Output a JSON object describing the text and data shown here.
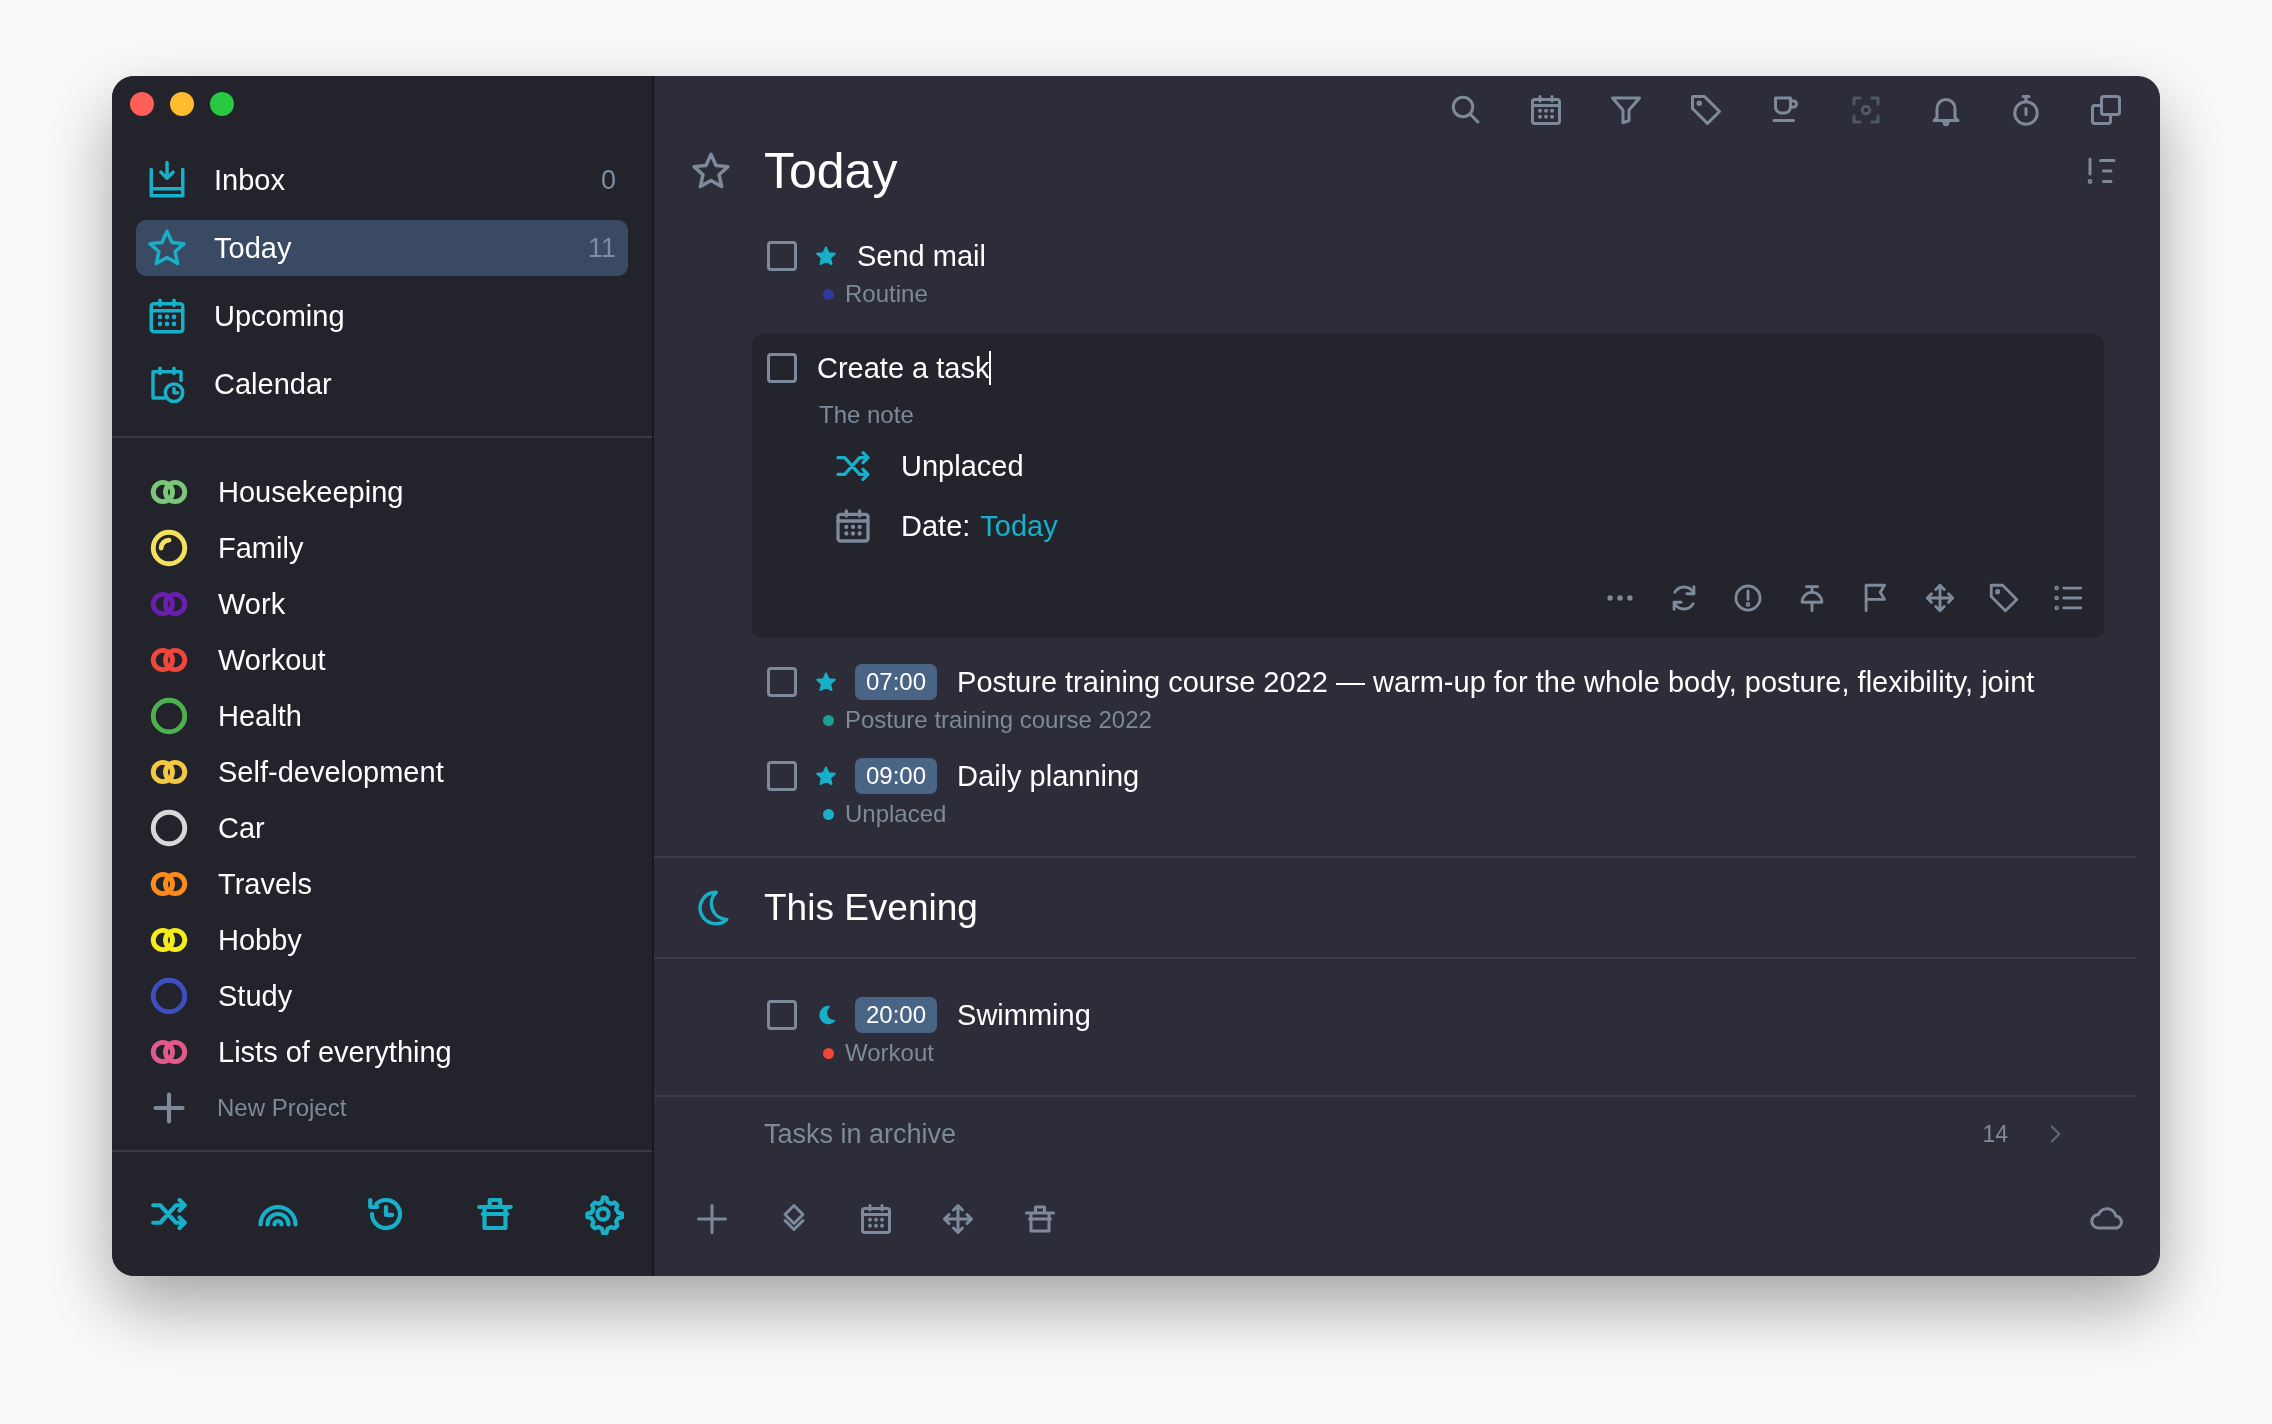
{
  "sidebar": {
    "nav": [
      {
        "label": "Inbox",
        "count": "0",
        "selected": false
      },
      {
        "label": "Today",
        "count": "11",
        "selected": true
      },
      {
        "label": "Upcoming",
        "selected": false
      },
      {
        "label": "Calendar",
        "selected": false
      }
    ],
    "projects": [
      {
        "name": "Housekeeping",
        "kind": "double",
        "color": "#7cc87a"
      },
      {
        "name": "Family",
        "kind": "arc",
        "color": "#f5e05a"
      },
      {
        "name": "Work",
        "kind": "double",
        "color": "#6a1fb0"
      },
      {
        "name": "Workout",
        "kind": "double",
        "color": "#f0463c"
      },
      {
        "name": "Health",
        "kind": "single",
        "color": "#4cb04c"
      },
      {
        "name": "Self-development",
        "kind": "double",
        "color": "#f5c842"
      },
      {
        "name": "Car",
        "kind": "single",
        "color": "#d8d8d8"
      },
      {
        "name": "Travels",
        "kind": "double",
        "color": "#ff8c1a"
      },
      {
        "name": "Hobby",
        "kind": "double",
        "color": "#f5ec1a"
      },
      {
        "name": "Study",
        "kind": "single",
        "color": "#3f4fc0"
      },
      {
        "name": "Lists of everything",
        "kind": "double",
        "color": "#e05a8a"
      }
    ],
    "new_project": "New Project"
  },
  "main": {
    "title": "Today",
    "sections": [
      {
        "tasks": [
          {
            "kind": "today",
            "title": "Send mail",
            "checked": false,
            "project": "Routine",
            "color": "#2f3aa0"
          },
          {
            "kind": "editing",
            "title": "Create a task",
            "checked": false,
            "note": "The note",
            "project": "Unplaced",
            "date_label": "Date:",
            "date": "Today"
          },
          {
            "kind": "today",
            "time": "07:00",
            "title": "Posture training course 2022 — warm-up for the whole body, posture, flexibility, joint",
            "checked": false,
            "project": "Posture training course 2022",
            "color": "#1aa090"
          },
          {
            "kind": "today",
            "time": "09:00",
            "title": "Daily planning",
            "checked": false,
            "project": "Unplaced",
            "color": "#1ab0c8"
          }
        ]
      },
      {
        "title": "This Evening",
        "tasks": [
          {
            "kind": "evening",
            "time": "20:00",
            "title": "Swimming",
            "checked": false,
            "project": "Workout",
            "color": "#f0463c"
          }
        ]
      }
    ],
    "archive": {
      "label": "Tasks in archive",
      "count": "14"
    }
  }
}
